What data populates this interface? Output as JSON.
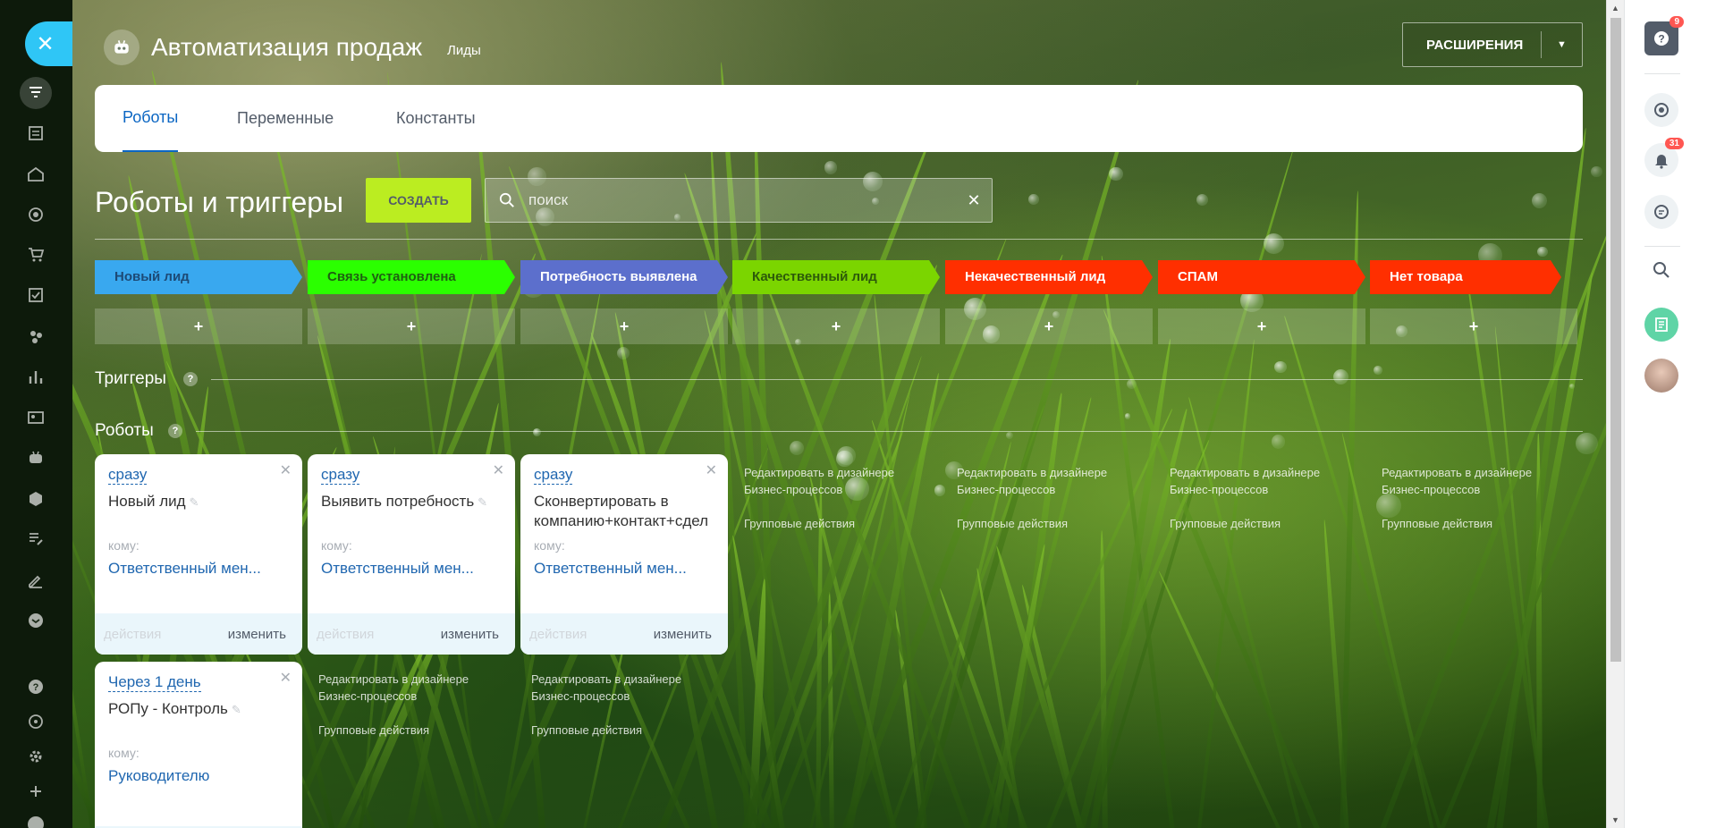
{
  "header": {
    "title": "Автоматизация продаж",
    "subtitle": "Лиды",
    "extensions_label": "РАСШИРЕНИЯ"
  },
  "tabs": [
    {
      "label": "Роботы",
      "active": true
    },
    {
      "label": "Переменные",
      "active": false
    },
    {
      "label": "Константы",
      "active": false
    }
  ],
  "toolbar": {
    "title": "Роботы и триггеры",
    "create_label": "СОЗДАТЬ",
    "search_placeholder": "поиск"
  },
  "stages": [
    {
      "label": "Новый лид",
      "bg": "#39a8ef",
      "fg": "#1d4a76"
    },
    {
      "label": "Связь установлена",
      "bg": "#2bff00",
      "fg": "#1f5f12"
    },
    {
      "label": "Потребность выявлена",
      "bg": "#5c6fcc",
      "fg": "#ffffff"
    },
    {
      "label": "Качественный лид",
      "bg": "#7bd500",
      "fg": "#2d5a0a"
    },
    {
      "label": "Некачественный лид",
      "bg": "#ff2f00",
      "fg": "#ffffff"
    },
    {
      "label": "СПАМ",
      "bg": "#ff2f00",
      "fg": "#ffffff"
    },
    {
      "label": "Нет товара",
      "bg": "#ff2f00",
      "fg": "#ffffff"
    }
  ],
  "add_symbol": "+",
  "sections": {
    "triggers": "Триггеры",
    "robots": "Роботы",
    "help": "?"
  },
  "robots": [
    {
      "when": "сразу",
      "name": "Новый лид",
      "to_label": "кому:",
      "who": "Ответственный мен...",
      "actions": "действия",
      "edit": "изменить"
    },
    {
      "when": "сразу",
      "name": "Выявить потребность",
      "to_label": "кому:",
      "who": "Ответственный мен...",
      "actions": "действия",
      "edit": "изменить"
    },
    {
      "when": "сразу",
      "name": "Сконвертировать в компанию+контакт+сдел",
      "to_label": "кому:",
      "who": "Ответственный мен...",
      "actions": "действия",
      "edit": "изменить"
    },
    {
      "when": "Через 1 день",
      "name": "РОПу - Контроль",
      "to_label": "кому:",
      "who": "Руководителю"
    }
  ],
  "designer_link": "Редактировать в дизайнере Бизнес-процессов",
  "group_actions": "Групповые действия",
  "right_panel": {
    "help_badge": "9",
    "notifications_badge": "31"
  }
}
